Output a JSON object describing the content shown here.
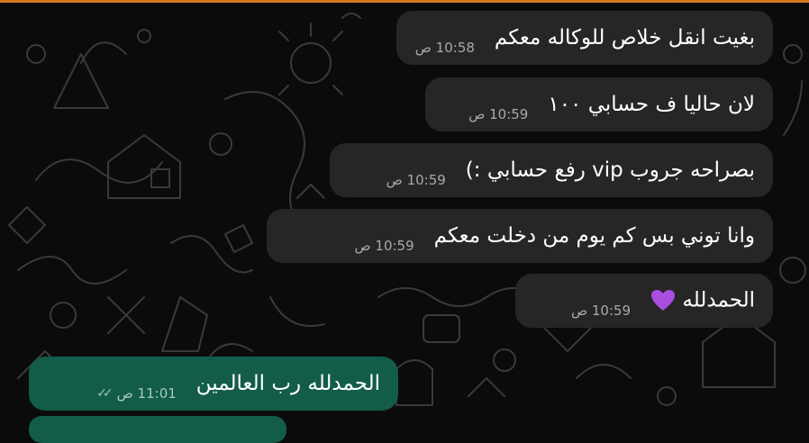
{
  "colors": {
    "background": "#0b0b0b",
    "incoming_bubble": "#262626",
    "outgoing_bubble": "#135c4a",
    "text": "#ffffff",
    "timestamp": "#a9a9a9",
    "heart": "#a84ee0"
  },
  "messages": [
    {
      "direction": "incoming",
      "text": "بغيت انقل خلاص للوكاله معكم",
      "time": "10:58 ص"
    },
    {
      "direction": "incoming",
      "text": "لان حاليا ف حسابي ١٠٠",
      "time": "10:59 ص"
    },
    {
      "direction": "incoming",
      "text": "بصراحه جروب vip رفع حسابي :)",
      "time": "10:59 ص"
    },
    {
      "direction": "incoming",
      "text": "وانا توني بس كم يوم من دخلت معكم",
      "time": "10:59 ص"
    },
    {
      "direction": "incoming",
      "text": "الحمدلله",
      "emoji": "purple-heart",
      "time": "10:59 ص"
    },
    {
      "direction": "outgoing",
      "text": "الحمدلله رب العالمين",
      "time": "11:01 ص",
      "status": "read"
    }
  ]
}
